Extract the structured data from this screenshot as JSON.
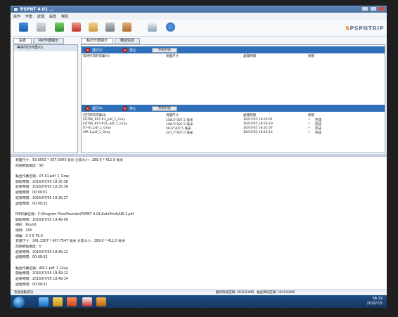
{
  "app": {
    "title": "PSPNT 4.01 ...",
    "logo": "PSPNTRIP",
    "logo_mark": "S"
  },
  "menu": [
    "操作",
    "作業",
    "處理",
    "設置",
    "幫助"
  ],
  "toolbar_icons": [
    "blue-cube-icon",
    "printer-icon",
    "green-plus-icon",
    "red-x-icon",
    "hand-icon",
    "pen-icon",
    "book-icon",
    "window-icon",
    "info-icon"
  ],
  "left": {
    "tabs": [
      "設置",
      "RIP作業顯示"
    ],
    "header": "等待列印作業(0)"
  },
  "right": {
    "tabs": [
      "輸出作業顯示",
      "幫助信息"
    ],
    "top_controls": {
      "run": "運行中",
      "stop": "停止",
      "list": "列表列表"
    },
    "top_columns": [
      "等待打印的作業(0)",
      "頁面尺寸",
      "處理時間",
      "狀態"
    ],
    "bottom_controls": {
      "run": "運行中",
      "stop": "停止",
      "list": "列表列表"
    },
    "bottom_columns": [
      "已打印的作業(5)",
      "頁面尺寸",
      "處理時間",
      "狀態"
    ],
    "rows": [
      {
        "name": "E0706_815-P3_pdf_1_Gray",
        "size": "158.5*307.5 毫米",
        "time": "16/07/05 18:26:01",
        "status": "完成"
      },
      {
        "name": "E0706_815-P31_pdf_1_Gray",
        "size": "158.5*307.5 毫米",
        "time": "16/07/05 18:26:18",
        "status": "完成"
      },
      {
        "name": "07-A1.pdf_1_Gray",
        "size": "59.6*307.5 毫米",
        "time": "16/07/05 18:35:37",
        "status": "完成"
      },
      {
        "name": "AIR-1.pdf_1_Gray",
        "size": "241.1*407.0 毫米",
        "time": "16/07/05 18:49:14",
        "status": "完成"
      }
    ]
  },
  "log": [
    "頁面尺寸：59.6053 * 307.5093 毫米  分質大小：289.0 * 412.0 毫米",
    "前頭節點角度：90",
    "",
    "輸出作業名稱：07-A1.pdf_1_Gray",
    "開始時間：2016/07/05 18:35:36",
    "結束時間：2016/07/05 18:35:36",
    "處理時間：00:00:01",
    "結束時間：2016/07/05 18:35:37",
    "處理時間：00:00:02",
    "",
    "RIP作業名稱：C:\\Program Files\\Founder\\PSPNT 4.01\\AutoPrint\\AIR-1.pdf",
    "開始時間：2016/07/05 19:49:09",
    "網形：Round",
    "網目：100",
    "網角：0 0 0 75.0",
    "頁面尺寸：241.1307 * 407.7547 毫米  分質大小：289.0 * 412.0 毫米",
    "前頭節點角度：0",
    "結束時間：2016/07/05 18:49:12",
    "處理時間：00:00:03",
    "",
    "輸出作業名稱：AIR-1.pdf_1_Gray",
    "開始時間：2016/07/05 18:49:12",
    "結束時間：2016/07/05 18:49:14",
    "處理時間：00:00:01"
  ],
  "status": {
    "left": "系統啟動成功",
    "disk1": "臨時目錄空間: 203193MB",
    "disk2": "輸出目錄空間: 203193MB"
  },
  "taskbar": {
    "time": "08:19",
    "date": "2016/7/5",
    "icons": [
      "windows-start-icon",
      "ie-icon",
      "folder-icon",
      "media-player-icon",
      "pspnt-icon",
      "app-icon"
    ]
  }
}
